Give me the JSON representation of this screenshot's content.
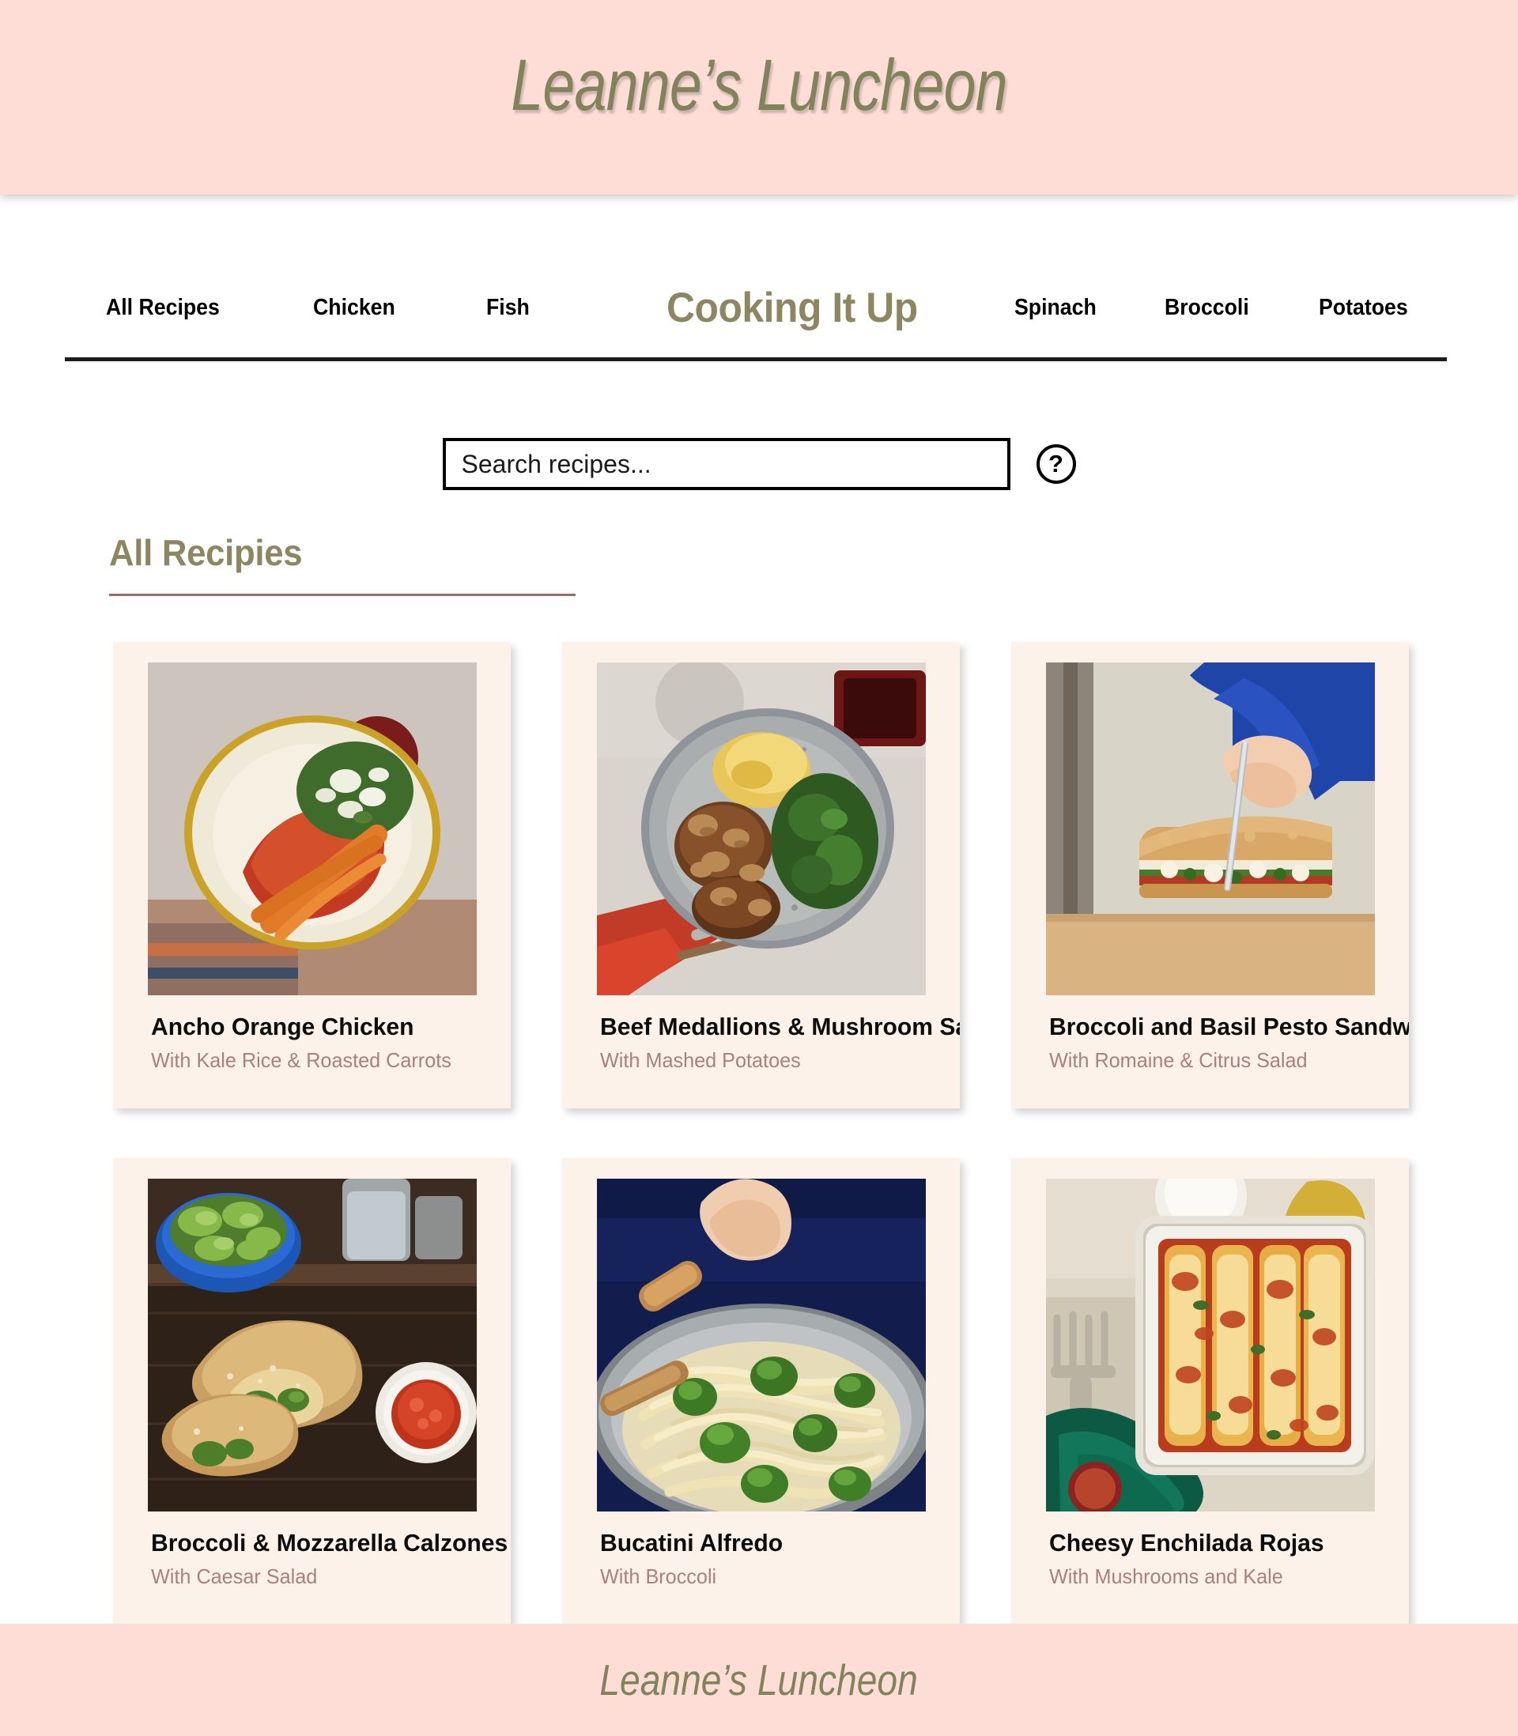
{
  "header": {
    "title": "Leanne’s Luncheon"
  },
  "nav": {
    "brand": "Cooking It Up",
    "left_items": [
      {
        "label": "All Recipes"
      },
      {
        "label": "Chicken"
      },
      {
        "label": "Fish"
      }
    ],
    "right_items": [
      {
        "label": "Spinach"
      },
      {
        "label": "Broccoli"
      },
      {
        "label": "Potatoes"
      }
    ]
  },
  "search": {
    "value": "",
    "placeholder": "Search recipes...",
    "help_icon": "question-mark-circle-icon",
    "help_label": "?"
  },
  "section": {
    "title": "All Recipies"
  },
  "recipes": [
    {
      "title": "Ancho Orange Chicken",
      "subtitle": "With Kale Rice & Roasted Carrots",
      "image_alt": "plate of ancho orange chicken with kale rice and carrots"
    },
    {
      "title": "Beef Medallions & Mushroom Sauce",
      "subtitle": "With Mashed Potatoes",
      "image_alt": "plate of beef medallions with mushroom sauce, mashed potatoes and greens"
    },
    {
      "title": "Broccoli and Basil Pesto Sandwiches",
      "subtitle": "With Romaine & Citrus Salad",
      "image_alt": "hands slicing a focaccia pesto sandwich on a cutting board"
    },
    {
      "title": "Broccoli & Mozzarella Calzones",
      "subtitle": "With Caesar Salad",
      "image_alt": "broccoli and mozzarella calzones with salad and marinara"
    },
    {
      "title": "Bucatini Alfredo",
      "subtitle": "With Broccoli",
      "image_alt": "pan of bucatini alfredo with broccoli and a wooden spoon"
    },
    {
      "title": "Cheesy Enchilada Rojas",
      "subtitle": "With Mushrooms and Kale",
      "image_alt": "baking dish of cheesy enchiladas rojas with green napkin"
    }
  ],
  "footer": {
    "title": "Leanne’s Luncheon"
  },
  "colors": {
    "header_pink": "#fdddd6",
    "olive": "#8d8662",
    "olive_title": "#82825c",
    "card_cream": "#fdf2e9",
    "subtitle_mauve": "#a8807e",
    "section_rule": "#9d6a66",
    "nav_rule": "#1c1c1c"
  }
}
